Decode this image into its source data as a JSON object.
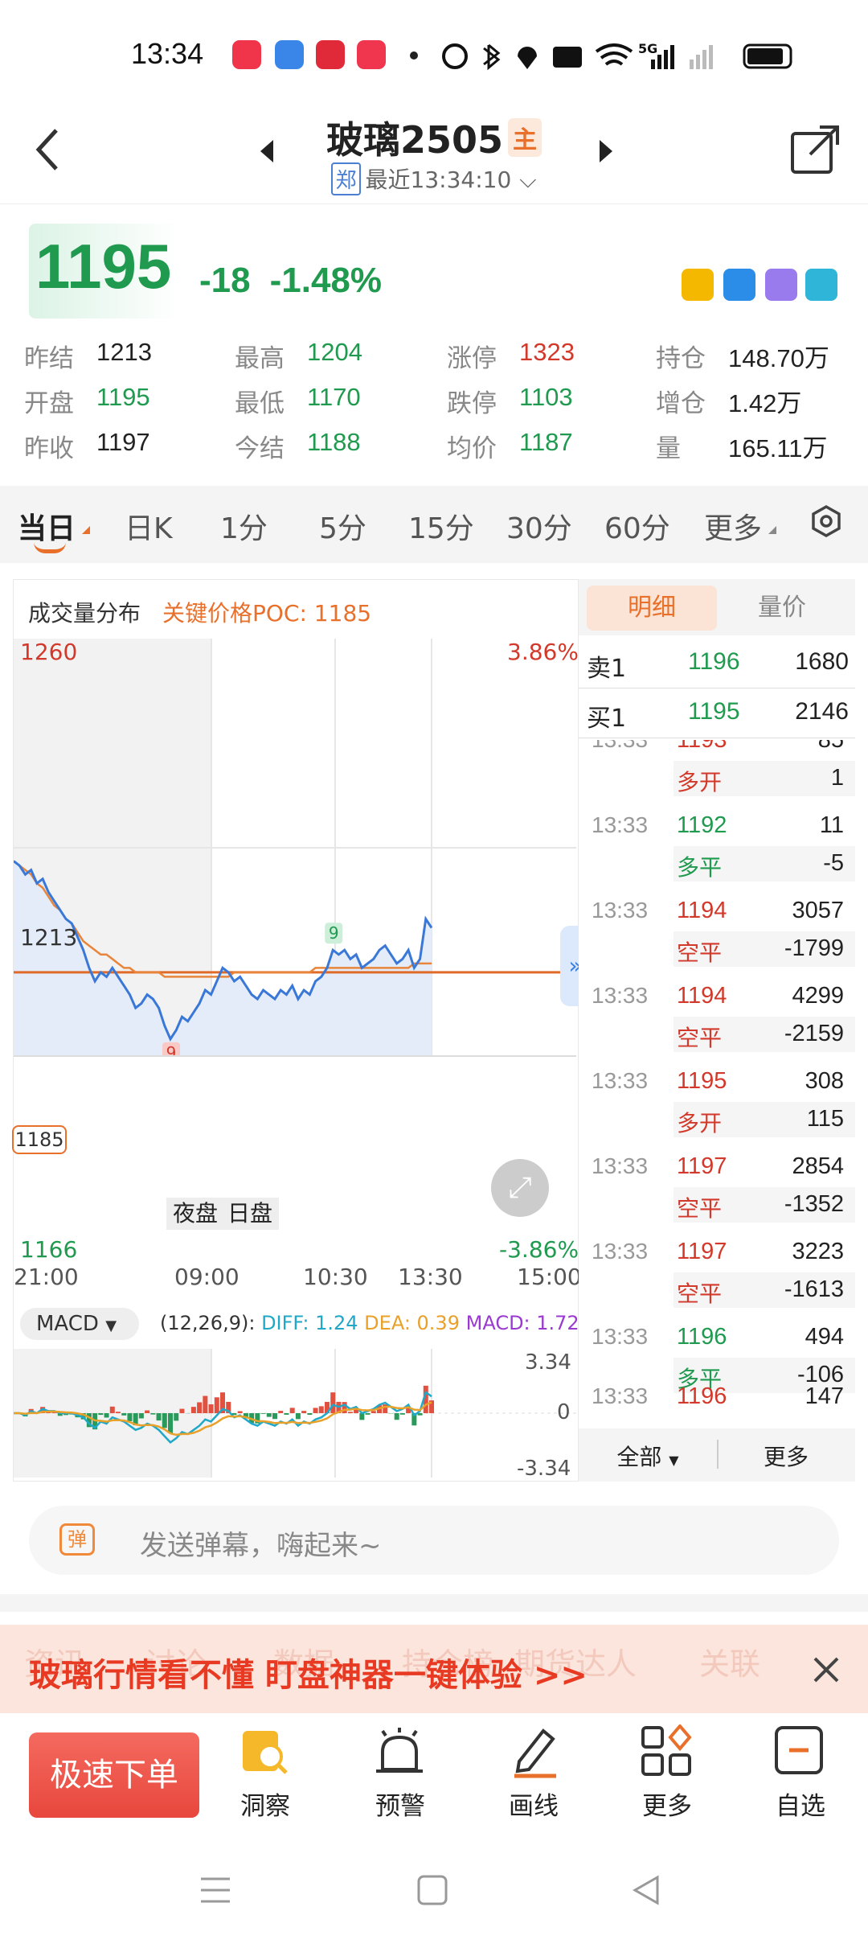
{
  "status": {
    "time": "13:34",
    "network": "5G"
  },
  "header": {
    "title": "玻璃2505",
    "tag": "主",
    "exchange": "郑",
    "updated": "最近13:34:10"
  },
  "quote": {
    "price": "1195",
    "change": "-18",
    "change_pct": "-1.48%"
  },
  "stats": [
    {
      "label": "昨结",
      "value": "1213",
      "color": "#222"
    },
    {
      "label": "最高",
      "value": "1204",
      "color": "#1f9a4f"
    },
    {
      "label": "涨停",
      "value": "1323",
      "color": "#d2392b"
    },
    {
      "label": "持仓",
      "value": "148.70万",
      "color": "#222"
    },
    {
      "label": "开盘",
      "value": "1195",
      "color": "#1f9a4f"
    },
    {
      "label": "最低",
      "value": "1170",
      "color": "#1f9a4f"
    },
    {
      "label": "跌停",
      "value": "1103",
      "color": "#1f9a4f"
    },
    {
      "label": "增仓",
      "value": "1.42万",
      "color": "#222"
    },
    {
      "label": "昨收",
      "value": "1197",
      "color": "#222"
    },
    {
      "label": "今结",
      "value": "1188",
      "color": "#1f9a4f"
    },
    {
      "label": "均价",
      "value": "1187",
      "color": "#1f9a4f"
    },
    {
      "label": "量",
      "value": "165.11万",
      "color": "#222"
    }
  ],
  "tabs": [
    "当日",
    "日K",
    "1分",
    "5分",
    "15分",
    "30分",
    "60分",
    "更多"
  ],
  "chart": {
    "vol_dist_label": "成交量分布",
    "poc_label": "关键价格POC: 1185",
    "y_top": "1260",
    "y_top_pct": "3.86%",
    "y_mid": "1213",
    "y_bottom": "1166",
    "y_bottom_pct": "-3.86%",
    "poc_tag": "1185",
    "x_labels": [
      "21:00",
      "09:00",
      "10:30",
      "13:30",
      "15:00"
    ],
    "session_night": "夜盘",
    "session_day": "日盘",
    "marker_low": "9",
    "marker_high": "9",
    "macd_btn": "MACD",
    "macd_params": "(12,26,9):",
    "diff": "DIFF: 1.24",
    "dea": "DEA: 0.39",
    "macd": "MACD: 1.72",
    "macd_top": "3.34",
    "macd_zero": "0",
    "macd_bottom": "-3.34"
  },
  "chart_data": {
    "type": "line",
    "title": "",
    "xlabel": "",
    "ylabel": "",
    "ylim": [
      1166,
      1260
    ],
    "x_ticks": [
      "21:00",
      "09:00",
      "10:30",
      "13:30",
      "15:00"
    ],
    "series": [
      {
        "values": [
          1210,
          1209,
          1207,
          1208,
          1205,
          1206,
          1203,
          1201,
          1199,
          1197,
          1196,
          1193,
          1190,
          1186,
          1183,
          1185,
          1184,
          1186,
          1184,
          1182,
          1180,
          1177,
          1178,
          1180,
          1179,
          1177,
          1173,
          1170,
          1172,
          1175,
          1174,
          1176,
          1178,
          1181,
          1180,
          1183,
          1186,
          1185,
          1183,
          1184,
          1182,
          1180,
          1179,
          1181,
          1180,
          1179,
          1181,
          1180,
          1182,
          1179,
          1181,
          1180,
          1183,
          1184,
          1186,
          1190,
          1189,
          1190,
          1188,
          1189,
          1186,
          1187,
          1188,
          1190,
          1191,
          1189,
          1187,
          1188,
          1190,
          1186,
          1188,
          1197,
          1195
        ]
      },
      {
        "values": [
          1210,
          1209,
          1208,
          1207,
          1205,
          1204,
          1202,
          1200,
          1199,
          1197,
          1196,
          1194,
          1192,
          1191,
          1190,
          1189,
          1189,
          1188,
          1187,
          1186,
          1186,
          1185,
          1185,
          1185,
          1185,
          1185,
          1184,
          1184,
          1184,
          1184,
          1184,
          1184,
          1184,
          1184,
          1184,
          1184,
          1184,
          1184,
          1185,
          1185,
          1185,
          1185,
          1185,
          1185,
          1185,
          1185,
          1185,
          1185,
          1185,
          1185,
          1185,
          1185,
          1186,
          1186,
          1186,
          1186,
          1186,
          1186,
          1186,
          1186,
          1186,
          1186,
          1186,
          1186,
          1186,
          1186,
          1186,
          1186,
          1186,
          1187,
          1187,
          1187,
          1187
        ]
      }
    ],
    "poc": 1185,
    "prev_settle": 1213,
    "macd": {
      "range": [
        -3.34,
        3.34
      ],
      "diff": 1.24,
      "dea": 0.39,
      "macd": 1.72
    }
  },
  "detail": {
    "tab_active": "明细",
    "tab_other": "量价",
    "sell1": {
      "label": "卖1",
      "price": "1196",
      "vol": "1680"
    },
    "buy1": {
      "label": "买1",
      "price": "1195",
      "vol": "2146"
    },
    "partial_top": {
      "time": "13:33",
      "price": "1193",
      "vol": "85",
      "action": "多开",
      "delta": "1"
    },
    "rows": [
      {
        "time": "13:33",
        "price": "1192",
        "vol": "11",
        "action": "多平",
        "delta": "-5",
        "color": "#1f9a4f"
      },
      {
        "time": "13:33",
        "price": "1194",
        "vol": "3057",
        "action": "空平",
        "delta": "-1799",
        "color": "#d2392b"
      },
      {
        "time": "13:33",
        "price": "1194",
        "vol": "4299",
        "action": "空平",
        "delta": "-2159",
        "color": "#d2392b"
      },
      {
        "time": "13:33",
        "price": "1195",
        "vol": "308",
        "action": "多开",
        "delta": "115",
        "color": "#d2392b"
      },
      {
        "time": "13:33",
        "price": "1197",
        "vol": "2854",
        "action": "空平",
        "delta": "-1352",
        "color": "#d2392b"
      },
      {
        "time": "13:33",
        "price": "1197",
        "vol": "3223",
        "action": "空平",
        "delta": "-1613",
        "color": "#d2392b"
      },
      {
        "time": "13:33",
        "price": "1196",
        "vol": "494",
        "action": "多平",
        "delta": "-106",
        "color": "#1f9a4f"
      }
    ],
    "partial_bottom": {
      "time": "13:33",
      "price": "1196",
      "vol": "147"
    },
    "filter": "全部",
    "more": "更多"
  },
  "danmu": {
    "icon": "弹",
    "placeholder": "发送弹幕，嗨起来~"
  },
  "banner": {
    "text": "玻璃行情看不懂 盯盘神器一键体验 >>",
    "behind": [
      "资讯",
      "讨论",
      "数据",
      "持仓榜",
      "期货达人",
      "关联"
    ]
  },
  "bottom": {
    "order_btn": "极速下单",
    "items": [
      "洞察",
      "预警",
      "画线",
      "更多",
      "自选"
    ]
  }
}
